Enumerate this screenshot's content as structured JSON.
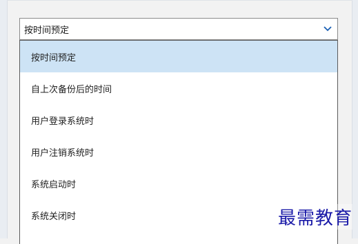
{
  "schedule_select": {
    "value": "按时间预定",
    "icon": "chevron-down-icon",
    "options": [
      "按时间预定",
      "自上次备份后的时间",
      "用户登录系统时",
      "用户注销系统时",
      "系统启动时",
      "系统关闭时"
    ],
    "selected_index": 0
  },
  "colors": {
    "selected_bg": "#cde3f5",
    "accent": "#1a5fb4",
    "watermark": "#1a1aa8"
  },
  "watermark": {
    "text": "最需教育"
  }
}
